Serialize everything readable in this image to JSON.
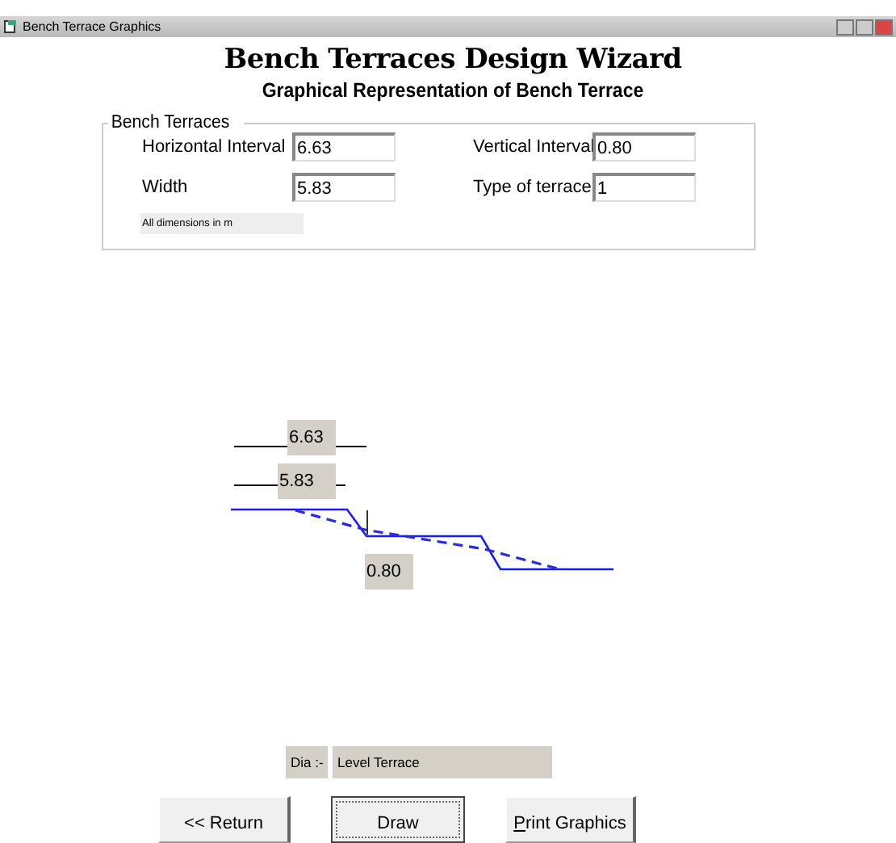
{
  "window": {
    "title": "Bench Terrace Graphics"
  },
  "heading": "Bench Terraces Design Wizard",
  "subheading": "Graphical Representation of Bench Terrace",
  "group": {
    "legend": "Bench Terraces",
    "fields": [
      {
        "label": "Horizontal Interval",
        "value": "6.63"
      },
      {
        "label": "Vertical Interval",
        "value": "0.80"
      },
      {
        "label": "Width",
        "value": "5.83"
      },
      {
        "label": "Type of terrace",
        "value": "1"
      }
    ],
    "note": "All dimensions in m"
  },
  "diagram": {
    "horizontal_label": "6.63",
    "width_label": "5.83",
    "vertical_label": "0.80"
  },
  "dia": {
    "label": "Dia :-",
    "value": "Level Terrace"
  },
  "buttons": [
    {
      "label": "<< Return",
      "focused": false
    },
    {
      "label": "Draw",
      "focused": true
    },
    {
      "label": "Print Graphics",
      "focused": false
    }
  ]
}
